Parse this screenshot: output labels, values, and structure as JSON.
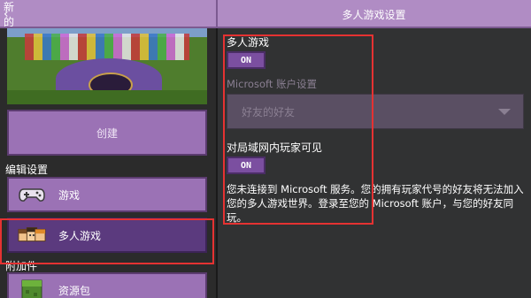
{
  "topbar": {
    "back_label": "创建新的世界",
    "right_title": "多人游戏设置"
  },
  "left": {
    "create_label": "创建",
    "edit_section": "编辑设置",
    "items": [
      {
        "label": "游戏",
        "icon": "gamepad-icon"
      },
      {
        "label": "多人游戏",
        "icon": "players-icon"
      }
    ],
    "addon_section": "附加件",
    "resource_label": "资源包"
  },
  "multiplayer": {
    "title": "多人游戏",
    "toggle": "ON"
  },
  "account": {
    "label": "Microsoft 账户设置",
    "dropdown_value": "好友的好友"
  },
  "lan": {
    "title": "对局域网内玩家可见",
    "toggle": "ON"
  },
  "info_text": "您未连接到 Microsoft 服务。您的拥有玩家代号的好友将无法加入您的多人游戏世界。登录至您的 Microsoft 账户，与您的好友同玩。",
  "colors": {
    "accent": "#9b72b5",
    "selected": "#5b3a7e",
    "highlight": "#e53232"
  }
}
